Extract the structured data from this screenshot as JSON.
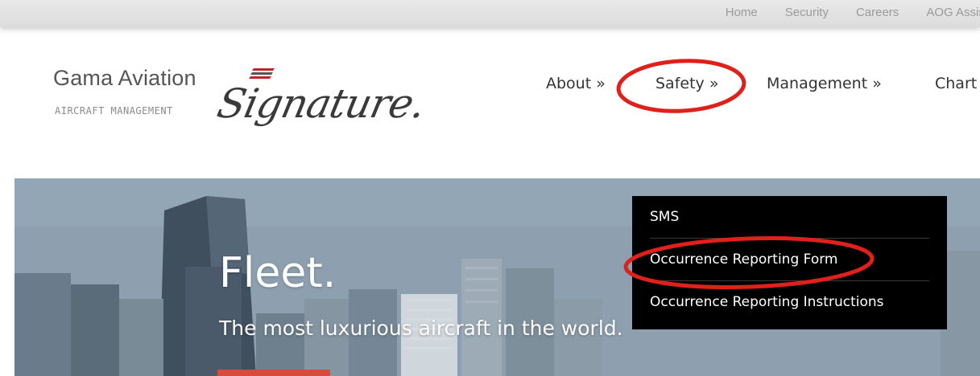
{
  "top_links": [
    "Home",
    "Security",
    "Careers",
    "AOG Assist"
  ],
  "logo": {
    "brand": "Gama Aviation",
    "subtitle": "AIRCRAFT MANAGEMENT",
    "script": "Signature."
  },
  "main_nav": [
    "About »",
    "Safety »",
    "Management »",
    "Chart"
  ],
  "hero": {
    "title": "Fleet.",
    "subtitle": "The most luxurious aircraft in the world."
  },
  "dropdown": {
    "items": [
      "SMS",
      "Occurrence Reporting Form",
      "Occurrence Reporting Instructions"
    ]
  },
  "annotations": {
    "color": "#e0201a",
    "highlighted": [
      "Safety »",
      "Occurrence Reporting Form"
    ]
  },
  "colors": {
    "topbar": "#e3e3e3",
    "dropdown_bg": "#000000",
    "accent": "#d94a3a"
  }
}
